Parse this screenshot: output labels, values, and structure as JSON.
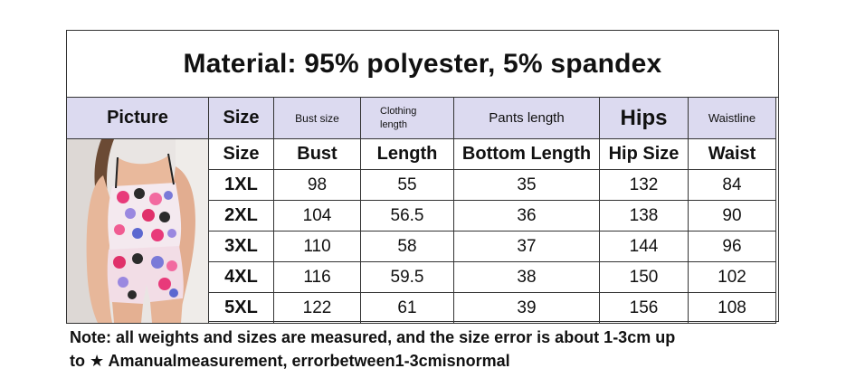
{
  "title": "Material: 95% polyester, 5% spandex",
  "header_row": {
    "picture": "Picture",
    "size": "Size",
    "bust": "Bust size",
    "clothing_length": "Clothing length",
    "pants_length": "Pants length",
    "hips": "Hips",
    "waistline": "Waistline"
  },
  "subheader_row": {
    "size": "Size",
    "bust": "Bust",
    "length": "Length",
    "bottom_length": "Bottom Length",
    "hip_size": "Hip Size",
    "waist": "Waist"
  },
  "rows": [
    {
      "size": "1XL",
      "bust": "98",
      "length": "55",
      "bottom_length": "35",
      "hip": "132",
      "waist": "84"
    },
    {
      "size": "2XL",
      "bust": "104",
      "length": "56.5",
      "bottom_length": "36",
      "hip": "138",
      "waist": "90"
    },
    {
      "size": "3XL",
      "bust": "110",
      "length": "58",
      "bottom_length": "37",
      "hip": "144",
      "waist": "96"
    },
    {
      "size": "4XL",
      "bust": "116",
      "length": "59.5",
      "bottom_length": "38",
      "hip": "150",
      "waist": "102"
    },
    {
      "size": "5XL",
      "bust": "122",
      "length": "61",
      "bottom_length": "39",
      "hip": "156",
      "waist": "108"
    }
  ],
  "note": {
    "line1": "Note: all weights and sizes are measured, and the size error is about 1-3cm up",
    "line2": "to ★ Amanualmeasurement, errorbetween1-3cmisnormal"
  },
  "colors": {
    "header_bg": "#dcdaf0",
    "border": "#333333",
    "photo_bg": "#e8e4e2"
  }
}
